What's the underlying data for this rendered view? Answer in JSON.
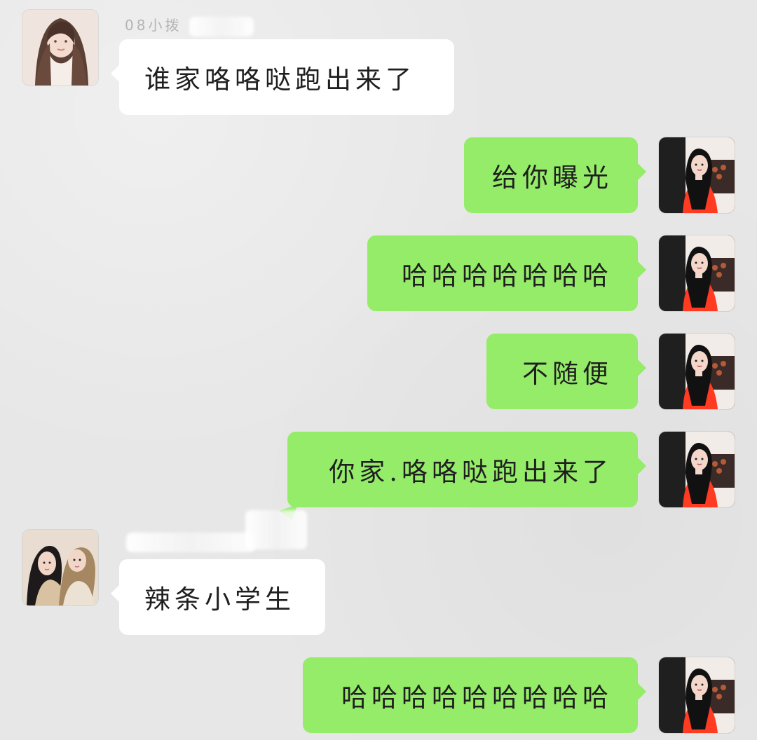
{
  "messages": [
    {
      "sender": "left",
      "sender_name": "08小拨",
      "text": "谁家咯咯哒跑出来了",
      "avatar_icon": "avatar-icon-girl-dark-hair"
    },
    {
      "sender": "right",
      "text": "给你曝光",
      "avatar_icon": "avatar-icon-girl-red-sweater"
    },
    {
      "sender": "right",
      "text": "哈哈哈哈哈哈哈",
      "avatar_icon": "avatar-icon-girl-red-sweater"
    },
    {
      "sender": "right",
      "text": "不随便",
      "avatar_icon": "avatar-icon-girl-red-sweater"
    },
    {
      "sender": "right",
      "text": "你家.咯咯哒跑出来了",
      "avatar_icon": "avatar-icon-girl-red-sweater"
    },
    {
      "sender": "left",
      "text": "辣条小学生",
      "avatar_icon": "avatar-icon-two-girls"
    },
    {
      "sender": "right",
      "text": "哈哈哈哈哈哈哈哈哈",
      "avatar_icon": "avatar-icon-girl-red-sweater"
    }
  ],
  "colors": {
    "background": "#e7e7e7",
    "incoming_bubble": "#ffffff",
    "outgoing_bubble": "#95ec69",
    "text": "#1f1f1f",
    "name_text": "#b4b4b4"
  }
}
